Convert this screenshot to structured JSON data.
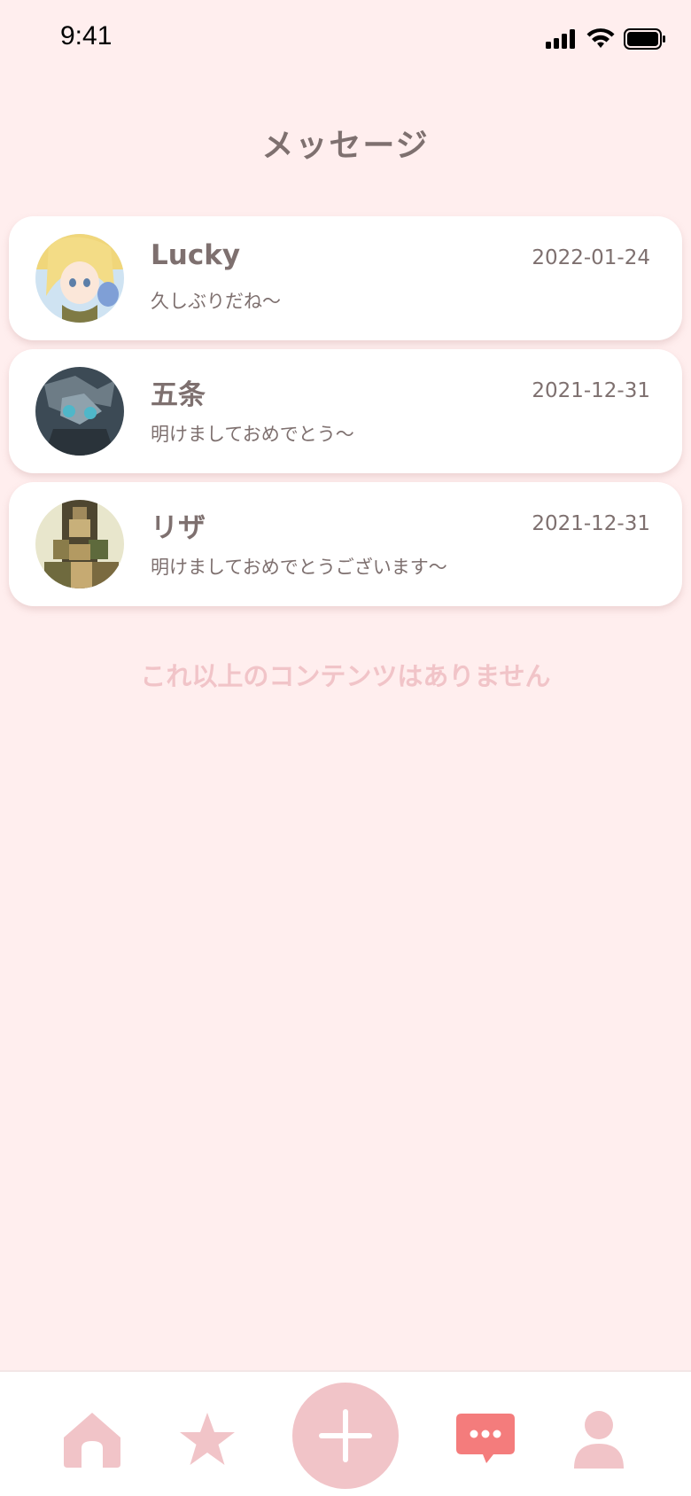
{
  "status_bar": {
    "time": "9:41"
  },
  "header": {
    "title": "メッセージ"
  },
  "messages": [
    {
      "name": "Lucky",
      "date": "2022-01-24",
      "preview": "久しぶりだね～"
    },
    {
      "name": "五条",
      "date": "2021-12-31",
      "preview": "明けましておめでとう～"
    },
    {
      "name": "リザ",
      "date": "2021-12-31",
      "preview": "明けましておめでとうございます～"
    }
  ],
  "list_end_text": "これ以上のコンテンツはありません",
  "colors": {
    "background": "#ffeeee",
    "text": "#7e706f",
    "accent_pink": "#f1c4c8",
    "active_tab": "#f47c7c"
  },
  "tab_bar": {
    "items": [
      {
        "icon": "home-icon",
        "active": false
      },
      {
        "icon": "star-icon",
        "active": false
      },
      {
        "icon": "plus-icon",
        "active": false
      },
      {
        "icon": "chat-icon",
        "active": true
      },
      {
        "icon": "profile-icon",
        "active": false
      }
    ]
  }
}
